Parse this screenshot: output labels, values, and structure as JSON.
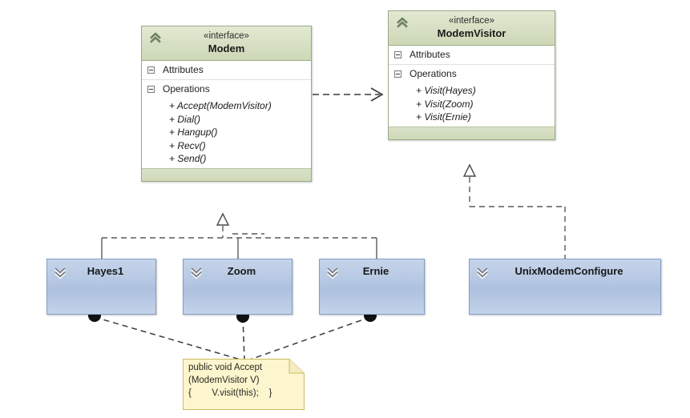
{
  "diagram": {
    "title": "Visitor pattern UML class diagram",
    "colors": {
      "interface_fill": "#d7e0c4",
      "interface_border": "#9aab86",
      "class_fill": "#b9caE4",
      "class_border": "#7f9ec4",
      "note_fill": "#fcf5cd",
      "note_border": "#d6c86a",
      "line": "#3a3a3a",
      "background": "#ffffff"
    }
  },
  "interfaces": [
    {
      "id": "modem",
      "stereotype": "«interface»",
      "name": "Modem",
      "icon": "interface-chevron-up-icon",
      "attributes_label": "Attributes",
      "operations_label": "Operations",
      "attributes": [],
      "operations": [
        "+ Accept(ModemVisitor)",
        "+ Dial()",
        "+ Hangup()",
        "+ Recv()",
        "+ Send()"
      ]
    },
    {
      "id": "modemvisitor",
      "stereotype": "«interface»",
      "name": "ModemVisitor",
      "icon": "interface-chevron-up-icon",
      "attributes_label": "Attributes",
      "operations_label": "Operations",
      "attributes": [],
      "operations": [
        "+ Visit(Hayes)",
        "+ Visit(Zoom)",
        "+ Visit(Ernie)"
      ]
    }
  ],
  "classes": [
    {
      "id": "hayes1",
      "name": "Hayes1",
      "icon": "class-chevron-down-icon"
    },
    {
      "id": "zoom",
      "name": "Zoom",
      "icon": "class-chevron-down-icon"
    },
    {
      "id": "ernie",
      "name": "Ernie",
      "icon": "class-chevron-down-icon"
    },
    {
      "id": "unixmodemconfigure",
      "name": "UnixModemConfigure",
      "icon": "class-chevron-down-icon"
    }
  ],
  "note": {
    "id": "accept-note",
    "line1": "public void Accept",
    "line2": "(ModemVisitor V)",
    "line3": "{        V.visit(this);    }",
    "text": "public void Accept\n(ModemVisitor V)\n{        V.visit(this);    }"
  },
  "relationships": [
    {
      "type": "dependency",
      "from": "Modem",
      "to": "ModemVisitor",
      "style": "dashed-open-arrow"
    },
    {
      "type": "realization",
      "from": "Hayes1",
      "to": "Modem",
      "style": "dashed-hollow-triangle"
    },
    {
      "type": "realization",
      "from": "Zoom",
      "to": "Modem",
      "style": "dashed-hollow-triangle"
    },
    {
      "type": "realization",
      "from": "Ernie",
      "to": "Modem",
      "style": "dashed-hollow-triangle"
    },
    {
      "type": "realization",
      "from": "UnixModemConfigure",
      "to": "ModemVisitor",
      "style": "dashed-hollow-triangle"
    },
    {
      "type": "note-anchor",
      "from": "accept-note",
      "to": "Hayes1",
      "style": "dashed-filled-dot"
    },
    {
      "type": "note-anchor",
      "from": "accept-note",
      "to": "Zoom",
      "style": "dashed-filled-dot"
    },
    {
      "type": "note-anchor",
      "from": "accept-note",
      "to": "Ernie",
      "style": "dashed-filled-dot"
    }
  ]
}
